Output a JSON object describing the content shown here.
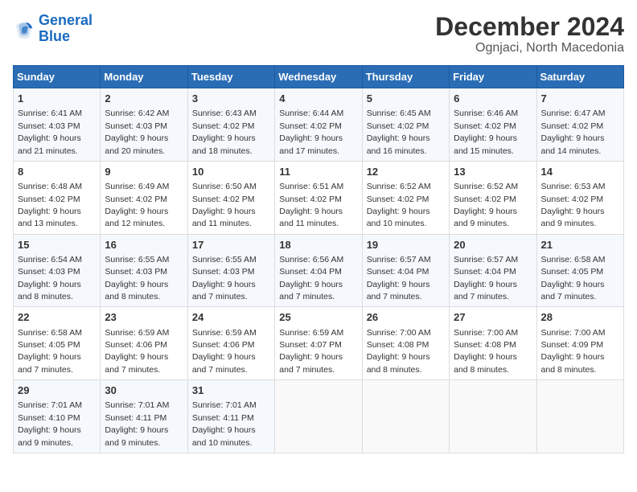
{
  "header": {
    "logo_line1": "General",
    "logo_line2": "Blue",
    "title": "December 2024",
    "subtitle": "Ognjaci, North Macedonia"
  },
  "weekdays": [
    "Sunday",
    "Monday",
    "Tuesday",
    "Wednesday",
    "Thursday",
    "Friday",
    "Saturday"
  ],
  "weeks": [
    [
      {
        "day": "1",
        "sunrise": "6:41 AM",
        "sunset": "4:03 PM",
        "daylight": "9 hours and 21 minutes."
      },
      {
        "day": "2",
        "sunrise": "6:42 AM",
        "sunset": "4:03 PM",
        "daylight": "9 hours and 20 minutes."
      },
      {
        "day": "3",
        "sunrise": "6:43 AM",
        "sunset": "4:02 PM",
        "daylight": "9 hours and 18 minutes."
      },
      {
        "day": "4",
        "sunrise": "6:44 AM",
        "sunset": "4:02 PM",
        "daylight": "9 hours and 17 minutes."
      },
      {
        "day": "5",
        "sunrise": "6:45 AM",
        "sunset": "4:02 PM",
        "daylight": "9 hours and 16 minutes."
      },
      {
        "day": "6",
        "sunrise": "6:46 AM",
        "sunset": "4:02 PM",
        "daylight": "9 hours and 15 minutes."
      },
      {
        "day": "7",
        "sunrise": "6:47 AM",
        "sunset": "4:02 PM",
        "daylight": "9 hours and 14 minutes."
      }
    ],
    [
      {
        "day": "8",
        "sunrise": "6:48 AM",
        "sunset": "4:02 PM",
        "daylight": "9 hours and 13 minutes."
      },
      {
        "day": "9",
        "sunrise": "6:49 AM",
        "sunset": "4:02 PM",
        "daylight": "9 hours and 12 minutes."
      },
      {
        "day": "10",
        "sunrise": "6:50 AM",
        "sunset": "4:02 PM",
        "daylight": "9 hours and 11 minutes."
      },
      {
        "day": "11",
        "sunrise": "6:51 AM",
        "sunset": "4:02 PM",
        "daylight": "9 hours and 11 minutes."
      },
      {
        "day": "12",
        "sunrise": "6:52 AM",
        "sunset": "4:02 PM",
        "daylight": "9 hours and 10 minutes."
      },
      {
        "day": "13",
        "sunrise": "6:52 AM",
        "sunset": "4:02 PM",
        "daylight": "9 hours and 9 minutes."
      },
      {
        "day": "14",
        "sunrise": "6:53 AM",
        "sunset": "4:02 PM",
        "daylight": "9 hours and 9 minutes."
      }
    ],
    [
      {
        "day": "15",
        "sunrise": "6:54 AM",
        "sunset": "4:03 PM",
        "daylight": "9 hours and 8 minutes."
      },
      {
        "day": "16",
        "sunrise": "6:55 AM",
        "sunset": "4:03 PM",
        "daylight": "9 hours and 8 minutes."
      },
      {
        "day": "17",
        "sunrise": "6:55 AM",
        "sunset": "4:03 PM",
        "daylight": "9 hours and 7 minutes."
      },
      {
        "day": "18",
        "sunrise": "6:56 AM",
        "sunset": "4:04 PM",
        "daylight": "9 hours and 7 minutes."
      },
      {
        "day": "19",
        "sunrise": "6:57 AM",
        "sunset": "4:04 PM",
        "daylight": "9 hours and 7 minutes."
      },
      {
        "day": "20",
        "sunrise": "6:57 AM",
        "sunset": "4:04 PM",
        "daylight": "9 hours and 7 minutes."
      },
      {
        "day": "21",
        "sunrise": "6:58 AM",
        "sunset": "4:05 PM",
        "daylight": "9 hours and 7 minutes."
      }
    ],
    [
      {
        "day": "22",
        "sunrise": "6:58 AM",
        "sunset": "4:05 PM",
        "daylight": "9 hours and 7 minutes."
      },
      {
        "day": "23",
        "sunrise": "6:59 AM",
        "sunset": "4:06 PM",
        "daylight": "9 hours and 7 minutes."
      },
      {
        "day": "24",
        "sunrise": "6:59 AM",
        "sunset": "4:06 PM",
        "daylight": "9 hours and 7 minutes."
      },
      {
        "day": "25",
        "sunrise": "6:59 AM",
        "sunset": "4:07 PM",
        "daylight": "9 hours and 7 minutes."
      },
      {
        "day": "26",
        "sunrise": "7:00 AM",
        "sunset": "4:08 PM",
        "daylight": "9 hours and 8 minutes."
      },
      {
        "day": "27",
        "sunrise": "7:00 AM",
        "sunset": "4:08 PM",
        "daylight": "9 hours and 8 minutes."
      },
      {
        "day": "28",
        "sunrise": "7:00 AM",
        "sunset": "4:09 PM",
        "daylight": "9 hours and 8 minutes."
      }
    ],
    [
      {
        "day": "29",
        "sunrise": "7:01 AM",
        "sunset": "4:10 PM",
        "daylight": "9 hours and 9 minutes."
      },
      {
        "day": "30",
        "sunrise": "7:01 AM",
        "sunset": "4:11 PM",
        "daylight": "9 hours and 9 minutes."
      },
      {
        "day": "31",
        "sunrise": "7:01 AM",
        "sunset": "4:11 PM",
        "daylight": "9 hours and 10 minutes."
      },
      null,
      null,
      null,
      null
    ]
  ]
}
